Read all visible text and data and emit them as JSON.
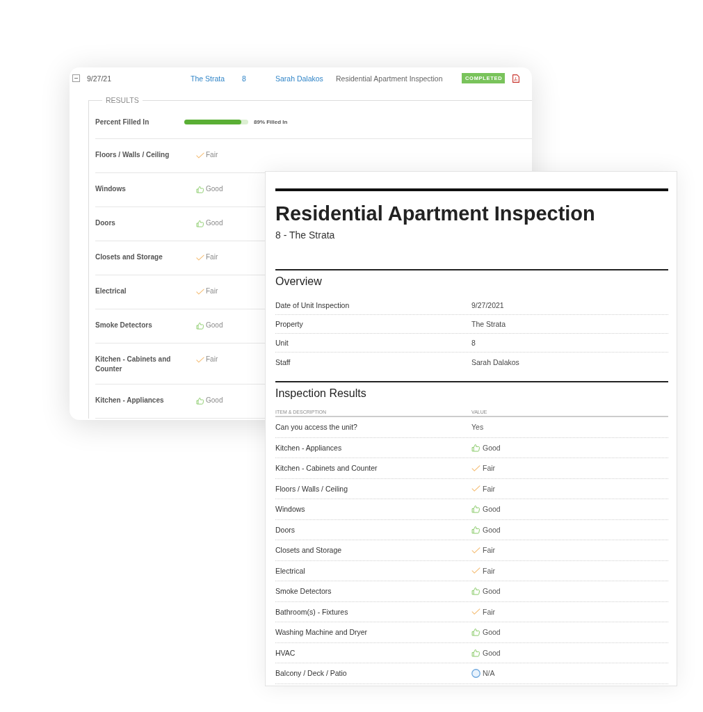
{
  "list_card": {
    "row": {
      "expanded": true,
      "date": "9/27/21",
      "property": "The Strata",
      "unit": "8",
      "staff": "Sarah Dalakos",
      "inspection": "Residential Apartment Inspection",
      "status": "COMPLETED"
    },
    "results": {
      "legend": "RESULTS",
      "progress": {
        "label": "Percent Filled In",
        "level": 0.89,
        "reading": "89% Filled In"
      },
      "items": [
        {
          "label": "Floors / Walls / Ceiling",
          "kind": "fair",
          "value": "Fair"
        },
        {
          "label": "Windows",
          "kind": "good",
          "value": "Good"
        },
        {
          "label": "Doors",
          "kind": "good",
          "value": "Good"
        },
        {
          "label": "Closets and Storage",
          "kind": "fair",
          "value": "Fair"
        },
        {
          "label": "Electrical",
          "kind": "fair",
          "value": "Fair"
        },
        {
          "label": "Smoke Detectors",
          "kind": "good",
          "value": "Good"
        },
        {
          "label": "Kitchen - Cabinets and Counter",
          "kind": "fair",
          "value": "Fair"
        },
        {
          "label": "Kitchen - Appliances",
          "kind": "good",
          "value": "Good"
        }
      ]
    }
  },
  "report": {
    "title": "Residential Apartment Inspection",
    "subtitle": "8 - The Strata",
    "overview": {
      "heading": "Overview",
      "fields": [
        {
          "label": "Date of Unit Inspection",
          "value": "9/27/2021"
        },
        {
          "label": "Property",
          "value": "The Strata"
        },
        {
          "label": "Unit",
          "value": "8"
        },
        {
          "label": "Staff",
          "value": "Sarah Dalakos"
        }
      ]
    },
    "results": {
      "heading": "Inspection Results",
      "columns": [
        "ITEM & DESCRIPTION",
        "VALUE"
      ],
      "rows": [
        {
          "item": "Can you access the unit?",
          "kind": "text",
          "value": "Yes"
        },
        {
          "item": "Kitchen - Appliances",
          "kind": "good",
          "value": "Good"
        },
        {
          "item": "Kitchen - Cabinets and Counter",
          "kind": "fair",
          "value": "Fair"
        },
        {
          "item": "Floors / Walls / Ceiling",
          "kind": "fair",
          "value": "Fair"
        },
        {
          "item": "Windows",
          "kind": "good",
          "value": "Good"
        },
        {
          "item": "Doors",
          "kind": "good",
          "value": "Good"
        },
        {
          "item": "Closets and Storage",
          "kind": "fair",
          "value": "Fair"
        },
        {
          "item": "Electrical",
          "kind": "fair",
          "value": "Fair"
        },
        {
          "item": "Smoke Detectors",
          "kind": "good",
          "value": "Good"
        },
        {
          "item": "Bathroom(s) - Fixtures",
          "kind": "fair",
          "value": "Fair"
        },
        {
          "item": "Washing Machine and Dryer",
          "kind": "good",
          "value": "Good"
        },
        {
          "item": "HVAC",
          "kind": "good",
          "value": "Good"
        },
        {
          "item": "Balcony / Deck / Patio",
          "kind": "na",
          "value": "N/A"
        }
      ]
    }
  }
}
